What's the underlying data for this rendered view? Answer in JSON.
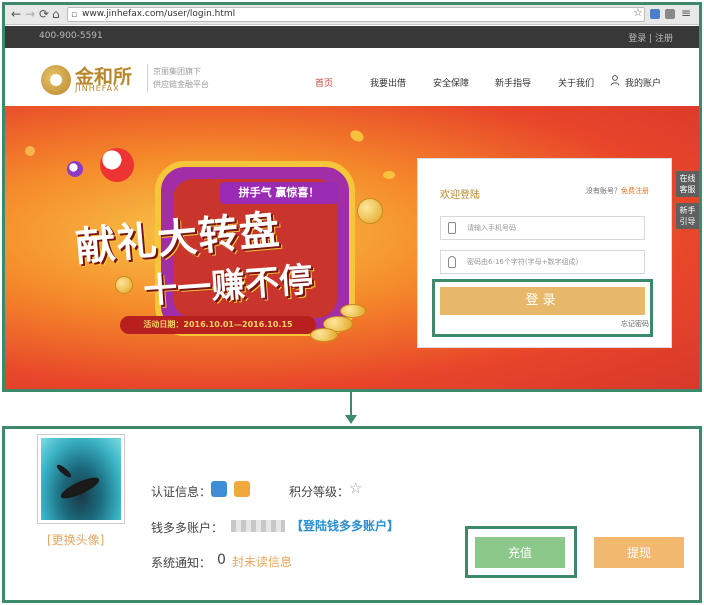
{
  "browser": {
    "url": "www.jinhefax.com/user/login.html"
  },
  "topbar": {
    "phone": "400-900-5591",
    "links": "登录 |  注册"
  },
  "header": {
    "logo_cn": "金和所",
    "logo_en": "JINHEFAX",
    "slogan_line1": "京丽集团旗下",
    "slogan_line2": "供应链金融平台",
    "menu": [
      {
        "label": "首页",
        "active": true
      },
      {
        "label": "我要出借"
      },
      {
        "label": "安全保障"
      },
      {
        "label": "新手指导"
      },
      {
        "label": "关于我们"
      },
      {
        "label": "我的账户"
      }
    ]
  },
  "banner": {
    "promo_tag": "拼手气  赢惊喜！",
    "headline_line1": "献礼大转盘",
    "headline_line2": "十一赚不停",
    "date_text": "活动日期：2016.10.01—2016.10.15"
  },
  "login": {
    "title": "欢迎登陆",
    "no_account": "没有账号？",
    "register_link": "免费注册",
    "phone_placeholder": "请输入手机号码",
    "password_placeholder": "密码由6-16个字符(字母+数字组成)",
    "submit_label": "登录",
    "forgot_label": "忘记密码"
  },
  "side_tabs": {
    "online_service": "在线客服",
    "newbie_guide": "新手引导"
  },
  "account": {
    "change_avatar": "[更换头像]",
    "cert_label": "认证信息：",
    "points_label": "积分等级：",
    "qdd_label": "钱多多账户：",
    "qdd_link": "【登陆钱多多账户】",
    "notify_label": "系统通知：",
    "notify_count": "0",
    "unread_label": "封未读信息",
    "recharge_label": "充值",
    "withdraw_label": "提现"
  }
}
